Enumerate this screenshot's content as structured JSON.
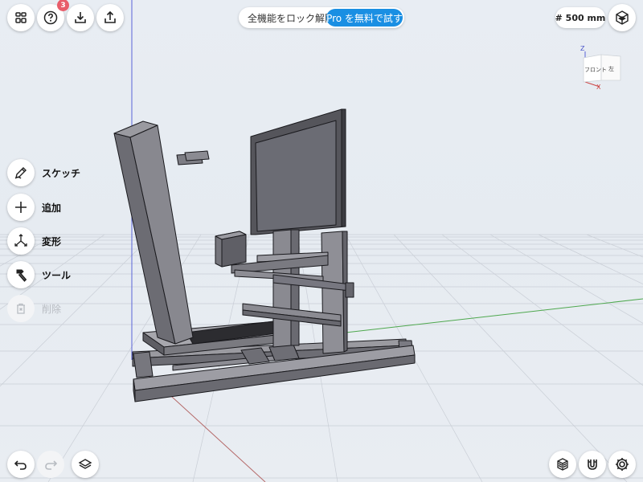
{
  "toolbar_top": {
    "help_badge": "3",
    "unlock_text": "全機能をロック解除",
    "pro_button": "Pro を無料で試す",
    "grid_size": "# 500 mm"
  },
  "view_cube": {
    "front_label": "フロント",
    "left_label": "左",
    "axis_z": "Z",
    "axis_x": "X"
  },
  "tools": [
    {
      "label": "スケッチ",
      "icon": "pencil-icon"
    },
    {
      "label": "追加",
      "icon": "plus-icon"
    },
    {
      "label": "変形",
      "icon": "transform-arrows-icon"
    },
    {
      "label": "ツール",
      "icon": "hammer-icon"
    },
    {
      "label": "削除",
      "icon": "trash-icon"
    }
  ],
  "colors": {
    "background": "#e8edf3",
    "accent": "#1a8fe3",
    "badge": "#e85d6a",
    "model_gray": "#707078"
  }
}
